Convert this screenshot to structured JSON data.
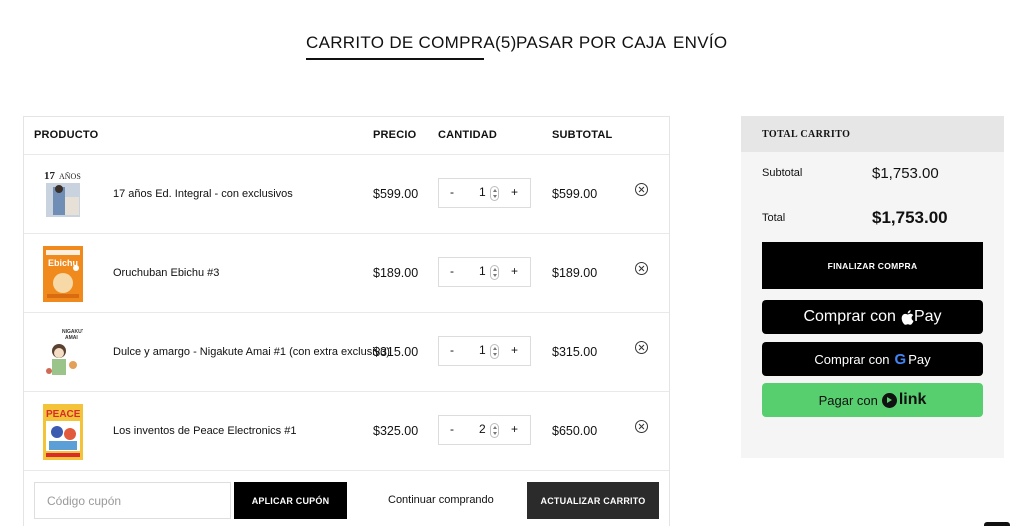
{
  "tabs": [
    {
      "label": "CARRITO DE COMPRA(5)",
      "active": true
    },
    {
      "label": "PASAR POR CAJA",
      "active": false
    },
    {
      "label": "ENVÍO",
      "active": false
    }
  ],
  "table": {
    "headers": {
      "product": "PRODUCTO",
      "price": "PRECIO",
      "quantity": "CANTIDAD",
      "subtotal": "SUBTOTAL"
    },
    "rows": [
      {
        "name": "17 años Ed. Integral - con exclusivos",
        "price": "$599.00",
        "quantity": "1",
        "subtotal": "$599.00"
      },
      {
        "name": "Oruchuban Ebichu #3",
        "price": "$189.00",
        "quantity": "1",
        "subtotal": "$189.00"
      },
      {
        "name": "Dulce y amargo - Nigakute Amai #1 (con extra exclusivo)",
        "price": "$315.00",
        "quantity": "1",
        "subtotal": "$315.00"
      },
      {
        "name": "Los inventos de Peace Electronics #1",
        "price": "$325.00",
        "quantity": "2",
        "subtotal": "$650.00"
      }
    ],
    "minus": "-",
    "plus": "+"
  },
  "footer": {
    "coupon_placeholder": "Código cupón",
    "apply_coupon": "APLICAR CUPÓN",
    "continue": "Continuar comprando",
    "update_cart": "ACTUALIZAR CARRITO"
  },
  "totals": {
    "title": "TOTAL CARRITO",
    "subtotal_label": "Subtotal",
    "subtotal_value": "$1,753.00",
    "total_label": "Total",
    "total_value": "$1,753.00",
    "checkout": "FINALIZAR COMPRA",
    "apple_pay_prefix": "Comprar con",
    "apple_pay_brand": "Pay",
    "google_pay_prefix": "Comprar con",
    "google_pay_brand_g": "G",
    "google_pay_brand": "Pay",
    "link_prefix": "Pagar con",
    "link_brand": "link"
  },
  "colors": {
    "link_green": "#58cf6f",
    "totals_bg": "#f5f5f5",
    "totals_header": "#e6e6e6"
  },
  "icons": [
    "remove-item-icon",
    "apple-logo-icon",
    "google-g-icon",
    "link-arrow-icon"
  ]
}
